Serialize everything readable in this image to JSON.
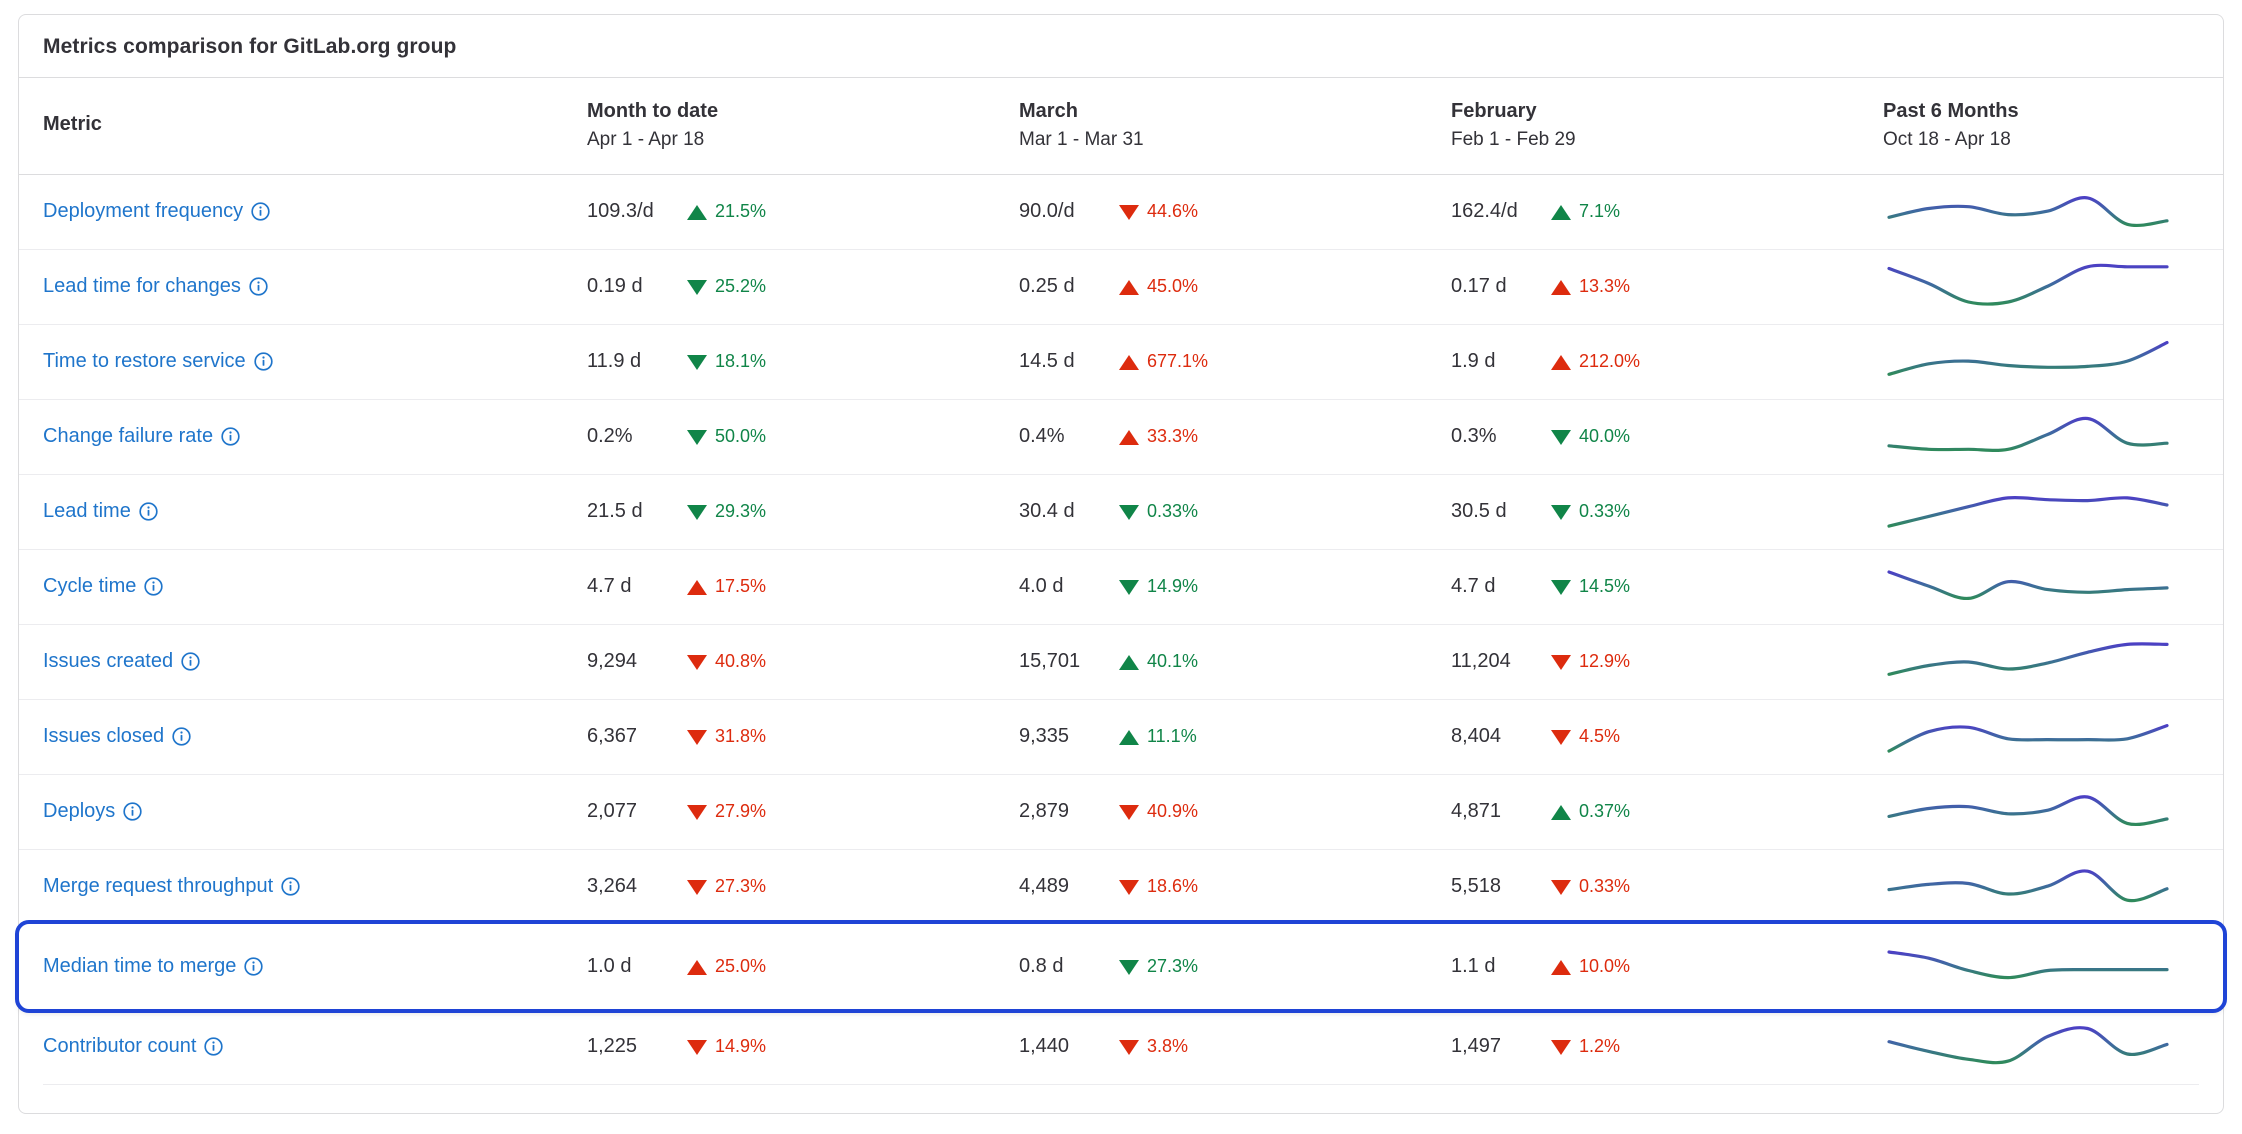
{
  "card": {
    "title": "Metrics comparison for GitLab.org group"
  },
  "table": {
    "columns": [
      {
        "title": "Metric",
        "sub": ""
      },
      {
        "title": "Month to date",
        "sub": "Apr 1 - Apr 18"
      },
      {
        "title": "March",
        "sub": "Mar 1 - Mar 31"
      },
      {
        "title": "February",
        "sub": "Feb 1 - Feb 29"
      },
      {
        "title": "Past 6 Months",
        "sub": "Oct 18 - Apr 18"
      }
    ],
    "rows": [
      {
        "metric": "Deployment frequency",
        "mtd": {
          "value": "109.3/d",
          "dir": "up",
          "pct": "21.5%",
          "tone": "good"
        },
        "march": {
          "value": "90.0/d",
          "dir": "down",
          "pct": "44.6%",
          "tone": "bad"
        },
        "feb": {
          "value": "162.4/d",
          "dir": "up",
          "pct": "7.1%",
          "tone": "good"
        }
      },
      {
        "metric": "Lead time for changes",
        "mtd": {
          "value": "0.19 d",
          "dir": "down",
          "pct": "25.2%",
          "tone": "good"
        },
        "march": {
          "value": "0.25 d",
          "dir": "up",
          "pct": "45.0%",
          "tone": "bad"
        },
        "feb": {
          "value": "0.17 d",
          "dir": "up",
          "pct": "13.3%",
          "tone": "bad"
        }
      },
      {
        "metric": "Time to restore service",
        "mtd": {
          "value": "11.9 d",
          "dir": "down",
          "pct": "18.1%",
          "tone": "good"
        },
        "march": {
          "value": "14.5 d",
          "dir": "up",
          "pct": "677.1%",
          "tone": "bad"
        },
        "feb": {
          "value": "1.9 d",
          "dir": "up",
          "pct": "212.0%",
          "tone": "bad"
        }
      },
      {
        "metric": "Change failure rate",
        "mtd": {
          "value": "0.2%",
          "dir": "down",
          "pct": "50.0%",
          "tone": "good"
        },
        "march": {
          "value": "0.4%",
          "dir": "up",
          "pct": "33.3%",
          "tone": "bad"
        },
        "feb": {
          "value": "0.3%",
          "dir": "down",
          "pct": "40.0%",
          "tone": "good"
        }
      },
      {
        "metric": "Lead time",
        "mtd": {
          "value": "21.5 d",
          "dir": "down",
          "pct": "29.3%",
          "tone": "good"
        },
        "march": {
          "value": "30.4 d",
          "dir": "down",
          "pct": "0.33%",
          "tone": "good"
        },
        "feb": {
          "value": "30.5 d",
          "dir": "down",
          "pct": "0.33%",
          "tone": "good"
        }
      },
      {
        "metric": "Cycle time",
        "mtd": {
          "value": "4.7 d",
          "dir": "up",
          "pct": "17.5%",
          "tone": "bad"
        },
        "march": {
          "value": "4.0 d",
          "dir": "down",
          "pct": "14.9%",
          "tone": "good"
        },
        "feb": {
          "value": "4.7 d",
          "dir": "down",
          "pct": "14.5%",
          "tone": "good"
        }
      },
      {
        "metric": "Issues created",
        "mtd": {
          "value": "9,294",
          "dir": "down",
          "pct": "40.8%",
          "tone": "bad"
        },
        "march": {
          "value": "15,701",
          "dir": "up",
          "pct": "40.1%",
          "tone": "good"
        },
        "feb": {
          "value": "11,204",
          "dir": "down",
          "pct": "12.9%",
          "tone": "bad"
        }
      },
      {
        "metric": "Issues closed",
        "mtd": {
          "value": "6,367",
          "dir": "down",
          "pct": "31.8%",
          "tone": "bad"
        },
        "march": {
          "value": "9,335",
          "dir": "up",
          "pct": "11.1%",
          "tone": "good"
        },
        "feb": {
          "value": "8,404",
          "dir": "down",
          "pct": "4.5%",
          "tone": "bad"
        }
      },
      {
        "metric": "Deploys",
        "mtd": {
          "value": "2,077",
          "dir": "down",
          "pct": "27.9%",
          "tone": "bad"
        },
        "march": {
          "value": "2,879",
          "dir": "down",
          "pct": "40.9%",
          "tone": "bad"
        },
        "feb": {
          "value": "4,871",
          "dir": "up",
          "pct": "0.37%",
          "tone": "good"
        }
      },
      {
        "metric": "Merge request throughput",
        "mtd": {
          "value": "3,264",
          "dir": "down",
          "pct": "27.3%",
          "tone": "bad"
        },
        "march": {
          "value": "4,489",
          "dir": "down",
          "pct": "18.6%",
          "tone": "bad"
        },
        "feb": {
          "value": "5,518",
          "dir": "down",
          "pct": "0.33%",
          "tone": "bad"
        }
      },
      {
        "metric": "Median time to merge",
        "highlighted": true,
        "mtd": {
          "value": "1.0 d",
          "dir": "up",
          "pct": "25.0%",
          "tone": "bad"
        },
        "march": {
          "value": "0.8 d",
          "dir": "down",
          "pct": "27.3%",
          "tone": "good"
        },
        "feb": {
          "value": "1.1 d",
          "dir": "up",
          "pct": "10.0%",
          "tone": "bad"
        }
      },
      {
        "metric": "Contributor count",
        "mtd": {
          "value": "1,225",
          "dir": "down",
          "pct": "14.9%",
          "tone": "bad"
        },
        "march": {
          "value": "1,440",
          "dir": "down",
          "pct": "3.8%",
          "tone": "bad"
        },
        "feb": {
          "value": "1,497",
          "dir": "down",
          "pct": "1.2%",
          "tone": "bad"
        }
      }
    ]
  },
  "chart_data": {
    "type": "line",
    "title": "Past 6 Months",
    "xlabel": "Oct 18 - Apr 18",
    "ylabel": "",
    "grid": false,
    "legend": "none",
    "note": "Sparkline trend per metric over the past 6 months; stroke is a green-to-purple gradient keyed to value.",
    "colors": {
      "low": "#2f8a5b",
      "high": "#4c40c4"
    },
    "series": [
      {
        "name": "Deployment frequency",
        "values": [
          0.38,
          0.58,
          0.62,
          0.44,
          0.52,
          0.82,
          0.22,
          0.3
        ]
      },
      {
        "name": "Lead time for changes",
        "values": [
          0.92,
          0.58,
          0.16,
          0.16,
          0.52,
          0.96,
          0.96,
          0.96
        ]
      },
      {
        "name": "Time to restore service",
        "values": [
          0.22,
          0.46,
          0.52,
          0.42,
          0.38,
          0.4,
          0.52,
          0.94
        ]
      },
      {
        "name": "Change failure rate",
        "values": [
          0.3,
          0.22,
          0.22,
          0.22,
          0.56,
          0.92,
          0.36,
          0.36
        ]
      },
      {
        "name": "Lead time",
        "values": [
          0.18,
          0.4,
          0.62,
          0.82,
          0.78,
          0.76,
          0.82,
          0.66
        ]
      },
      {
        "name": "Cycle time",
        "values": [
          0.84,
          0.52,
          0.24,
          0.62,
          0.44,
          0.38,
          0.44,
          0.48
        ]
      },
      {
        "name": "Issues created",
        "values": [
          0.22,
          0.42,
          0.5,
          0.34,
          0.48,
          0.72,
          0.9,
          0.9
        ]
      },
      {
        "name": "Issues closed",
        "values": [
          0.18,
          0.62,
          0.72,
          0.46,
          0.44,
          0.44,
          0.46,
          0.76
        ]
      },
      {
        "name": "Deploys",
        "values": [
          0.4,
          0.58,
          0.62,
          0.46,
          0.54,
          0.84,
          0.24,
          0.34
        ]
      },
      {
        "name": "Merge request throughput",
        "values": [
          0.44,
          0.56,
          0.58,
          0.34,
          0.52,
          0.86,
          0.2,
          0.46
        ]
      },
      {
        "name": "Median time to merge",
        "values": [
          0.84,
          0.7,
          0.42,
          0.26,
          0.42,
          0.44,
          0.44,
          0.44
        ]
      },
      {
        "name": "Contributor count",
        "values": [
          0.62,
          0.4,
          0.22,
          0.18,
          0.74,
          0.92,
          0.34,
          0.56
        ]
      }
    ]
  }
}
